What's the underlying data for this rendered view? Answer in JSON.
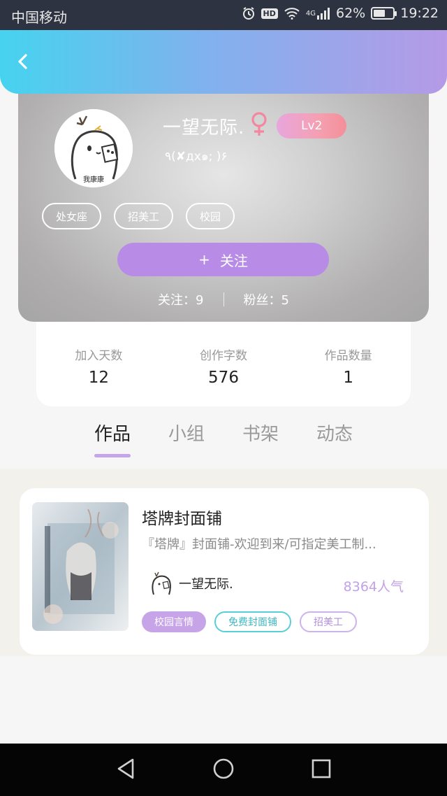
{
  "status_bar": {
    "carrier": "中国移动",
    "hd": "HD",
    "network": "4G",
    "battery_percent": "62%",
    "battery_level": 0.62,
    "time": "19:22"
  },
  "header": {
    "back_icon": "chevron-left-icon"
  },
  "profile": {
    "avatar_caption": "我康康",
    "nickname": "一望无际.",
    "gender_icon": "female-icon",
    "level": "Lv2",
    "signature": "٩(✘дx๑; )۶",
    "tags": [
      "处女座",
      "招美工",
      "校园"
    ],
    "follow_button": {
      "plus": "+",
      "label": "关注"
    },
    "following": "关注：9",
    "followers": "粉丝：5"
  },
  "stats": [
    {
      "label": "加入天数",
      "value": "12"
    },
    {
      "label": "创作字数",
      "value": "576"
    },
    {
      "label": "作品数量",
      "value": "1"
    }
  ],
  "tabs": [
    {
      "label": "作品",
      "active": true
    },
    {
      "label": "小组",
      "active": false
    },
    {
      "label": "书架",
      "active": false
    },
    {
      "label": "动态",
      "active": false
    }
  ],
  "work": {
    "title": "塔牌封面铺",
    "description": "『塔牌』封面铺-欢迎到来/可指定美工制...",
    "author": "一望无际.",
    "popularity": "8364人气",
    "tags": [
      "校园言情",
      "免费封面铺",
      "招美工"
    ]
  },
  "colors": {
    "accent_purple": "#b88ce6",
    "header_gradient_start": "#46d3ef",
    "header_gradient_end": "#b59ae6",
    "popularity": "#c3a2e6"
  }
}
